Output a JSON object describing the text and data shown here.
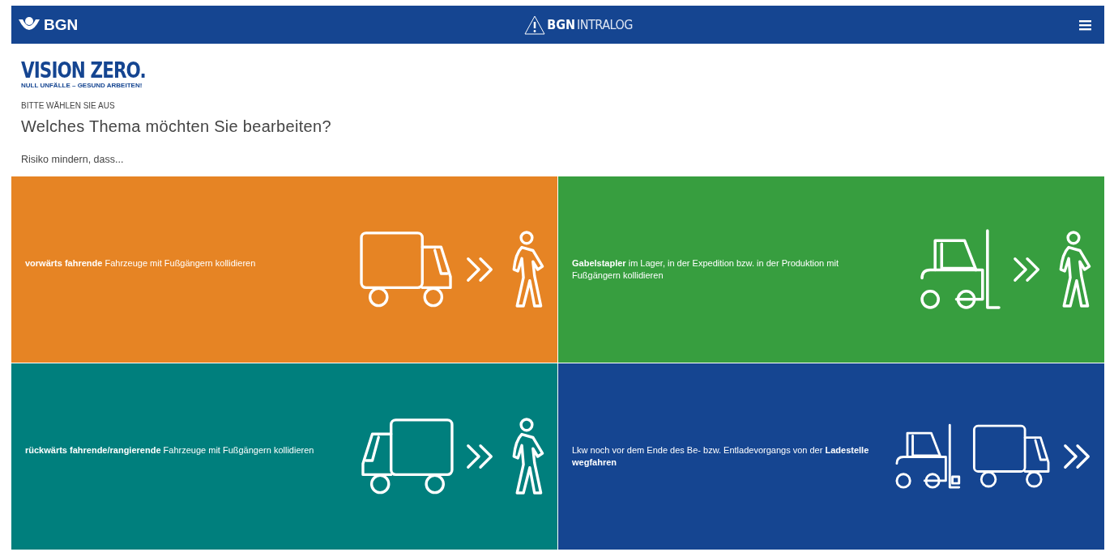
{
  "header": {
    "logo_text": "BGN",
    "app_brand": "BGN",
    "app_name": "INTRALOG"
  },
  "intro": {
    "title": "VISION ZERO.",
    "subtitle": "NULL UNFÄLLE – GESUND ARBEITEN!",
    "eyebrow": "BITTE WÄHLEN SIE AUS",
    "heading": "Welches Thema möchten Sie bearbeiten?",
    "lead": "Risiko mindern, dass..."
  },
  "tiles": [
    {
      "text": "**vorwärts fahrende** Fahrzeuge mit Fußgängern kollidieren",
      "color": "#e68424",
      "kind": "truck-front"
    },
    {
      "text": "**Gabelstapler** im Lager, in der Expedition bzw. in der Produktion mit Fußgängern kollidieren",
      "color": "#379e3f",
      "kind": "forklift"
    },
    {
      "text": "**rückwärts fahrende/rangierende** Fahrzeuge mit Fußgängern kollidieren",
      "color": "#007f7d",
      "kind": "truck-rear"
    },
    {
      "text": "Lkw noch vor dem Ende des Be- bzw. Entladevorgangs von der **Ladestelle wegfahren**",
      "color": "#154591",
      "kind": "loading"
    }
  ]
}
